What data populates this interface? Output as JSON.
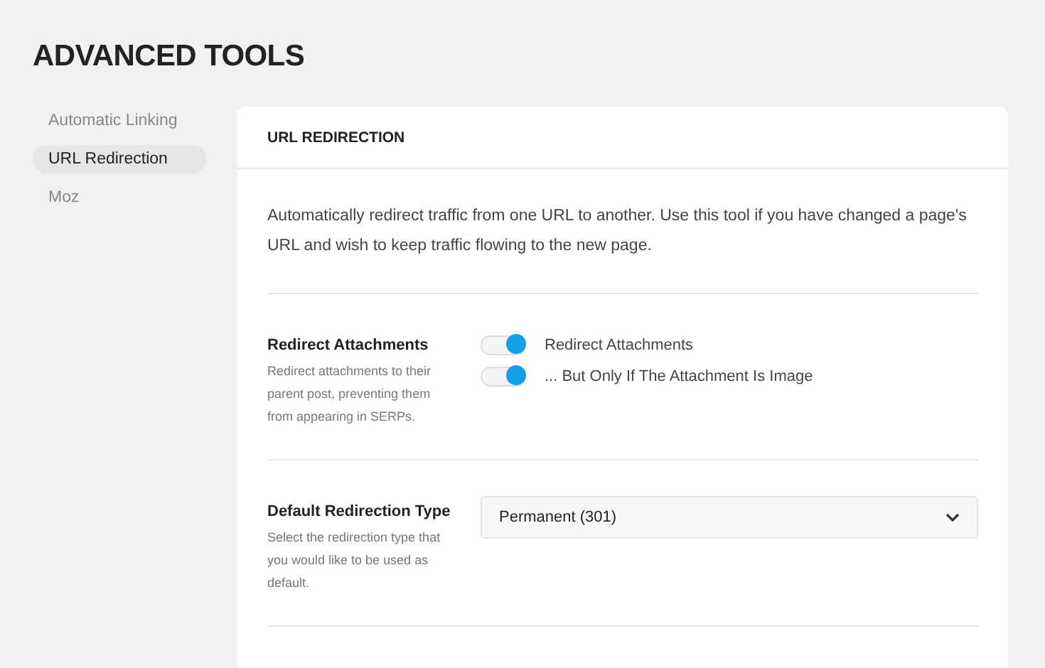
{
  "page_title": "ADVANCED TOOLS",
  "sidebar": {
    "items": [
      {
        "label": "Automatic Linking",
        "selected": false
      },
      {
        "label": "URL Redirection",
        "selected": true
      },
      {
        "label": "Moz",
        "selected": false
      }
    ]
  },
  "panel": {
    "title": "URL REDIRECTION",
    "description": "Automatically redirect traffic from one URL to another. Use this tool if you have changed a page's URL and wish to keep traffic flowing to the new page.",
    "settings": [
      {
        "kind": "toggles",
        "label": "Redirect Attachments",
        "help": "Redirect attachments to their parent post, preventing them from appearing in SERPs.",
        "toggles": [
          {
            "label": "Redirect Attachments",
            "on": true
          },
          {
            "label": "... But Only If The Attachment Is Image",
            "on": true
          }
        ]
      },
      {
        "kind": "select",
        "label": "Default Redirection Type",
        "help": "Select the redirection type that you would like to be used as default.",
        "value": "Permanent (301)"
      }
    ]
  }
}
